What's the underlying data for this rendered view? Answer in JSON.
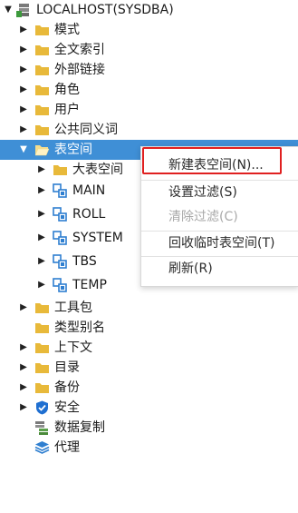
{
  "tree": {
    "root": {
      "label": "LOCALHOST(SYSDBA)",
      "icon": "server-icon"
    },
    "items": [
      {
        "label": "模式",
        "icon": "folder-icon"
      },
      {
        "label": "全文索引",
        "icon": "folder-icon"
      },
      {
        "label": "外部链接",
        "icon": "folder-icon"
      },
      {
        "label": "角色",
        "icon": "folder-icon"
      },
      {
        "label": "用户",
        "icon": "folder-icon"
      },
      {
        "label": "公共同义词",
        "icon": "folder-icon"
      },
      {
        "label": "表空间",
        "icon": "folder-open-icon",
        "selected": true
      },
      {
        "label": "大表空间",
        "icon": "folder-icon"
      },
      {
        "label": "MAIN",
        "icon": "tablespace-icon"
      },
      {
        "label": "ROLL",
        "icon": "tablespace-icon"
      },
      {
        "label": "SYSTEM",
        "icon": "tablespace-icon"
      },
      {
        "label": "TBS",
        "icon": "tablespace-icon"
      },
      {
        "label": "TEMP",
        "icon": "tablespace-icon"
      },
      {
        "label": "工具包",
        "icon": "folder-icon"
      },
      {
        "label": "类型别名",
        "icon": "folder-icon"
      },
      {
        "label": "上下文",
        "icon": "folder-icon"
      },
      {
        "label": "目录",
        "icon": "folder-icon"
      },
      {
        "label": "备份",
        "icon": "folder-icon"
      },
      {
        "label": "安全",
        "icon": "shield-icon"
      },
      {
        "label": "数据复制",
        "icon": "replication-icon"
      },
      {
        "label": "代理",
        "icon": "agent-stack-icon"
      }
    ]
  },
  "context_menu": {
    "items": [
      {
        "label": "新建表空间(N)...",
        "enabled": true
      },
      {
        "label": "设置过滤(S)",
        "enabled": true
      },
      {
        "label": "清除过滤(C)",
        "enabled": false
      },
      {
        "label": "回收临时表空间(T)",
        "enabled": true
      },
      {
        "label": "刷新(R)",
        "enabled": true
      }
    ]
  },
  "colors": {
    "selection": "#3f8fd6",
    "folder": "#e8b93a",
    "tablespace": "#2f7fd0",
    "highlight_box": "#e02020"
  }
}
